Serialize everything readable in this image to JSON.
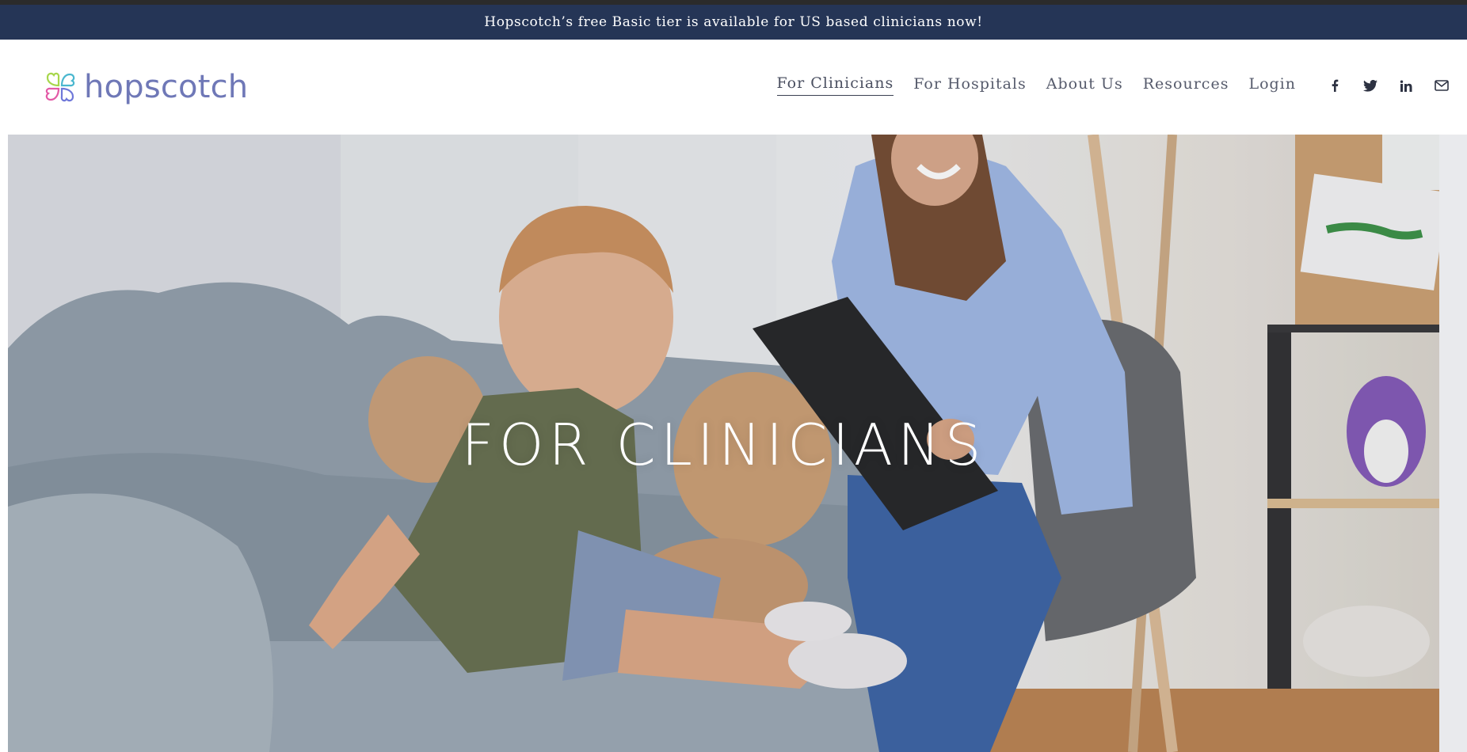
{
  "announcement": {
    "text": "Hopscotch’s free Basic tier is available for US based clinicians now!"
  },
  "brand": {
    "name": "hopscotch",
    "colors": {
      "wordmark": "#6f78b7",
      "announcement_bg": "#253556",
      "nav_text": "#555a6b"
    }
  },
  "nav": {
    "items": [
      {
        "label": "For Clinicians",
        "active": true
      },
      {
        "label": "For Hospitals",
        "active": false
      },
      {
        "label": "About Us",
        "active": false
      },
      {
        "label": "Resources",
        "active": false
      },
      {
        "label": "Login",
        "active": false
      }
    ],
    "social": [
      {
        "icon": "facebook-icon"
      },
      {
        "icon": "twitter-icon"
      },
      {
        "icon": "linkedin-icon"
      },
      {
        "icon": "email-icon"
      }
    ]
  },
  "hero": {
    "title": "FOR CLINICIANS",
    "image": "clinician-with-child-photo"
  }
}
